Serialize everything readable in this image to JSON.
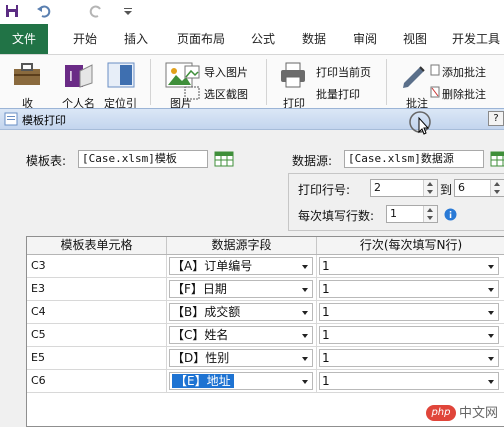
{
  "ribbon_tabs": [
    "文件",
    "开始",
    "插入",
    "页面布局",
    "公式",
    "数据",
    "审阅",
    "视图",
    "开发工具"
  ],
  "ribbon": {
    "btn_collect": "收",
    "btn_personal": "个人名",
    "btn_locate": "定位引",
    "btn_image": "图片",
    "btn_import_image": "导入图片",
    "btn_select_area_screenshot": "选区截图",
    "btn_print": "打印",
    "btn_print_current": "打印当前页",
    "btn_batch_print": "批量打印",
    "btn_annotate": "批注",
    "btn_add_annotation": "添加批注",
    "btn_delete_annotation": "删除批注"
  },
  "dialog": {
    "title": "模板打印",
    "template_label": "模板表:",
    "template_value": "[Case.xlsm]模板",
    "datasource_label": "数据源:",
    "datasource_value": "[Case.xlsm]数据源",
    "print_rows_label": "打印行号:",
    "row_from": "2",
    "to_label": "到",
    "row_to": "6",
    "per_fill_label": "每次填写行数:",
    "per_fill_value": "1",
    "info_icon": "info-icon"
  },
  "grid": {
    "headers": [
      "模板表单元格",
      "数据源字段",
      "行次(每次填写N行)"
    ],
    "rows": [
      {
        "cell": "C3",
        "field": "【A】订单编号",
        "row": "1"
      },
      {
        "cell": "E3",
        "field": "【F】日期",
        "row": "1"
      },
      {
        "cell": "C4",
        "field": "【B】成交额",
        "row": "1"
      },
      {
        "cell": "C5",
        "field": "【C】姓名",
        "row": "1"
      },
      {
        "cell": "E5",
        "field": "【D】性别",
        "row": "1"
      },
      {
        "cell": "C6",
        "field": "【E】地址",
        "row": "1"
      }
    ],
    "selected_row_index": 5
  },
  "watermark": {
    "logo": "php",
    "text": "中文网"
  },
  "colors": {
    "file_tab": "#217346",
    "selection": "#1e73d2",
    "info": "#2a7ad6"
  }
}
